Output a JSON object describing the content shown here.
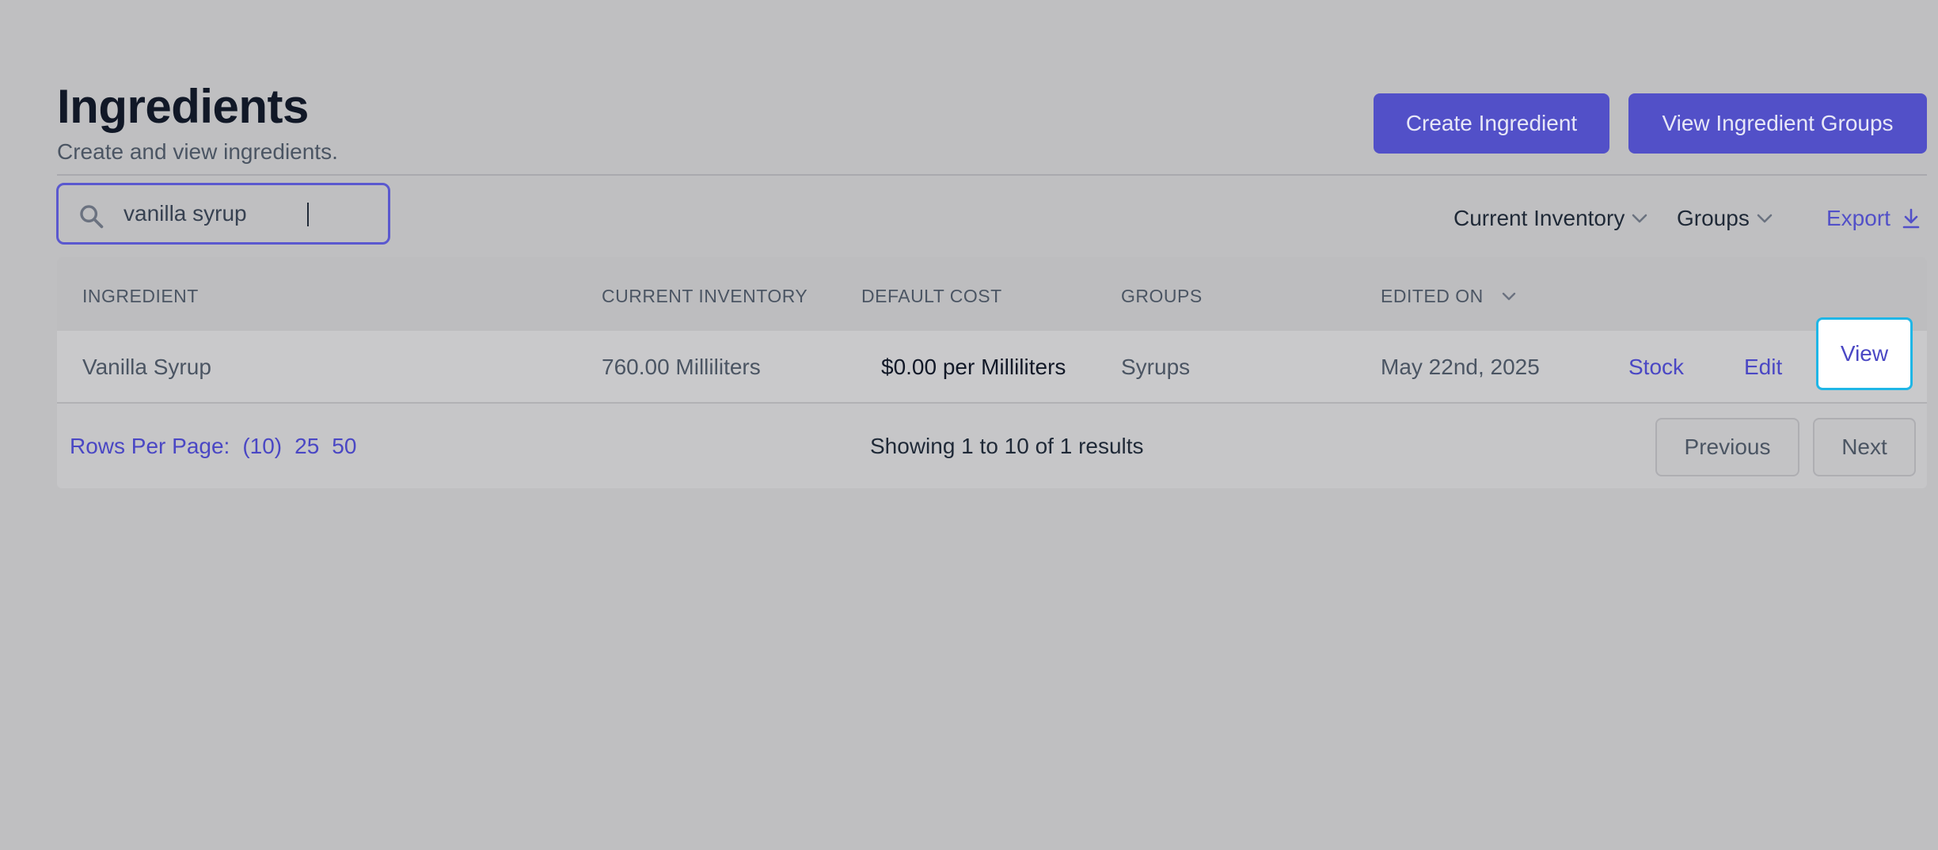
{
  "header": {
    "title": "Ingredients",
    "subtitle": "Create and view ingredients.",
    "create_button": "Create Ingredient",
    "groups_button": "View Ingredient Groups"
  },
  "search": {
    "value": "vanilla syrup",
    "icon": "search-icon"
  },
  "filters": {
    "inventory": "Current Inventory",
    "groups": "Groups",
    "export": "Export"
  },
  "table": {
    "columns": [
      "INGREDIENT",
      "CURRENT INVENTORY",
      "DEFAULT COST",
      "GROUPS",
      "EDITED ON"
    ],
    "rows": [
      {
        "ingredient": "Vanilla Syrup",
        "inventory": "760.00 Milliliters",
        "cost": "$0.00 per Milliliters",
        "groups": "Syrups",
        "edited_on": "May 22nd, 2025",
        "actions": [
          "Stock",
          "Edit",
          "View"
        ]
      }
    ]
  },
  "footer": {
    "rows_per_page_label": "Rows Per Page:",
    "rows_per_page_options": [
      "(10)",
      "25",
      "50"
    ],
    "showing": "Showing 1 to 10 of 1 results",
    "previous": "Previous",
    "next": "Next"
  },
  "colors": {
    "accent": "#5250c8",
    "focus_ring": "#1fb6e6",
    "background": "#bfbfc1"
  }
}
